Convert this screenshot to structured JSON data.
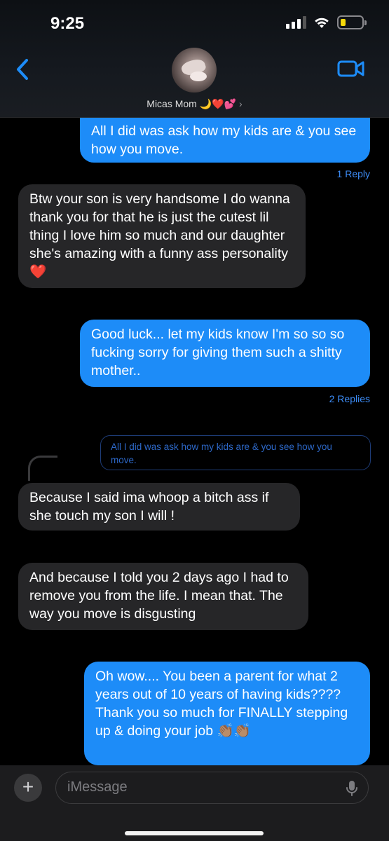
{
  "status": {
    "time": "9:25"
  },
  "contact": {
    "name": "Micas Mom 🌙❤️💕",
    "chevron": "›"
  },
  "messages": [
    {
      "type": "sent",
      "text": "All I did was ask how my kids are & you see how you move.",
      "replies": "1 Reply"
    },
    {
      "type": "received",
      "text": "Btw your son is very handsome I do wanna thank you for that he is just the cutest lil thing I love him so much and our daughter she's amazing with a funny ass personality ❤️"
    },
    {
      "type": "sent",
      "text": "Good luck... let my kids know I'm so so so fucking sorry for giving them such a shitty mother..",
      "replies": "2 Replies"
    },
    {
      "type": "quoted",
      "text": "All I did was ask how my kids are & you see how you move."
    },
    {
      "type": "received",
      "text": "Because I said ima whoop a bitch ass if she touch my son I will !"
    },
    {
      "type": "received",
      "text": "And because I told you 2 days ago I had to remove you from the life. I mean that. The way you move is disgusting"
    },
    {
      "type": "sent",
      "text": "Oh wow.... You been a parent for what 2 years out of 10 years of having kids???? Thank you so much for FINALLY stepping up & doing your job 👏🏽👏🏽"
    }
  ],
  "input": {
    "placeholder": "iMessage",
    "plus": "+"
  },
  "colors": {
    "sent": "#1d8cf8",
    "received": "#262628",
    "accent": "#3d8cf6"
  },
  "icons": [
    "back-chevron-icon",
    "video-camera-icon",
    "signal-icon",
    "wifi-icon",
    "battery-icon",
    "plus-icon",
    "microphone-icon"
  ]
}
